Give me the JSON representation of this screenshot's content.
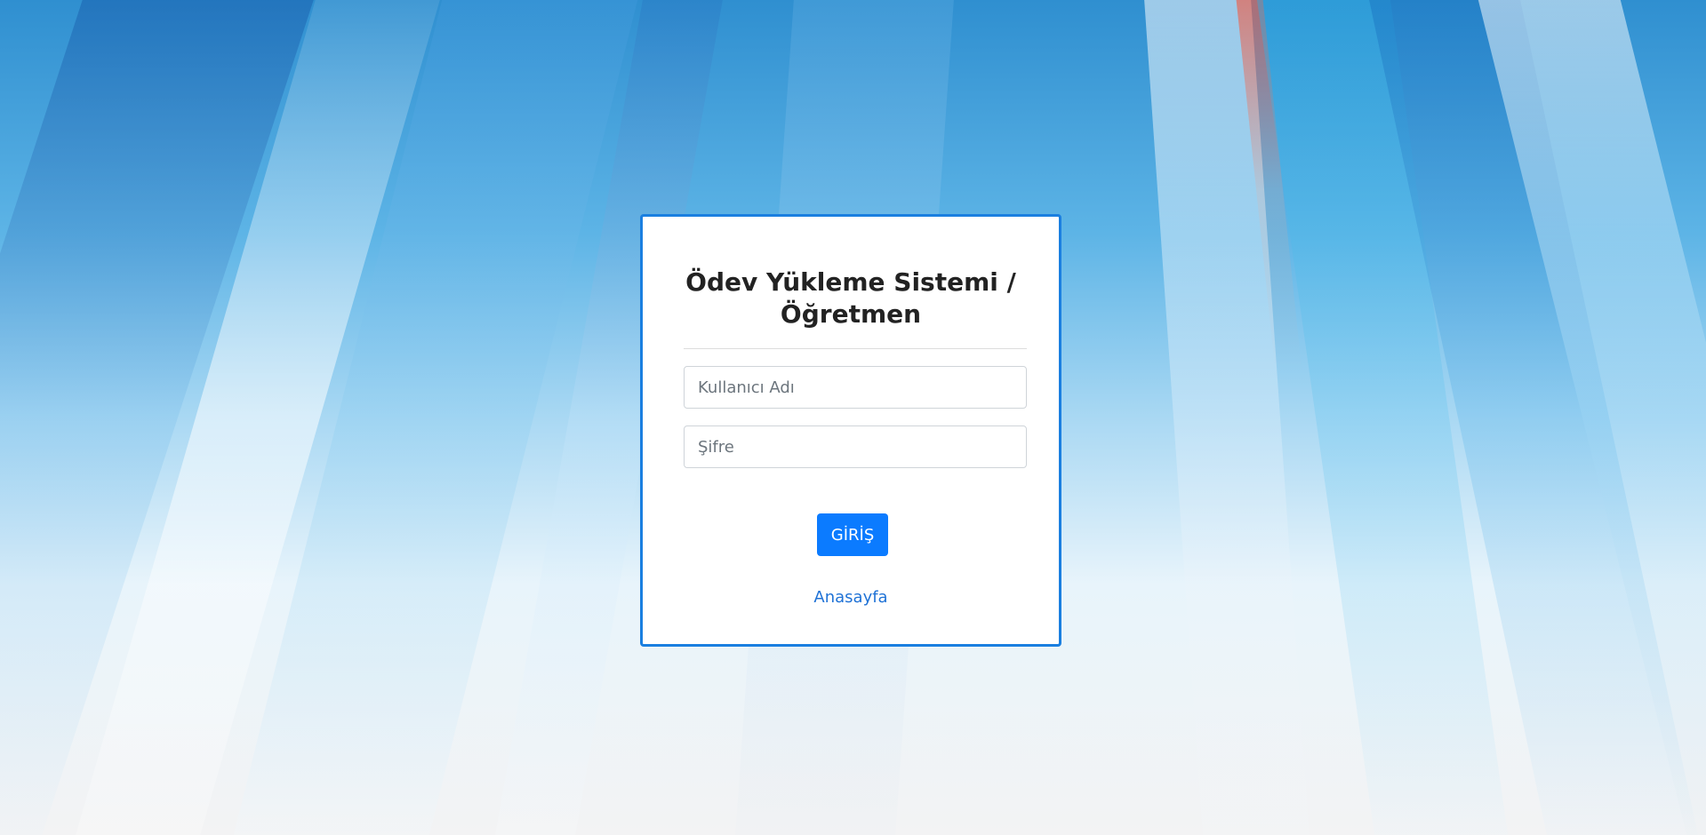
{
  "login": {
    "title": "Ödev Yükleme Sistemi / Öğretmen",
    "username_placeholder": "Kullanıcı Adı",
    "username_value": "",
    "password_placeholder": "Şifre",
    "password_value": "",
    "submit_label": "GİRİŞ",
    "home_link": "Anasayfa"
  },
  "colors": {
    "accent": "#0b7bff",
    "card_border": "#1a7fe0",
    "link": "#1f72d6"
  }
}
